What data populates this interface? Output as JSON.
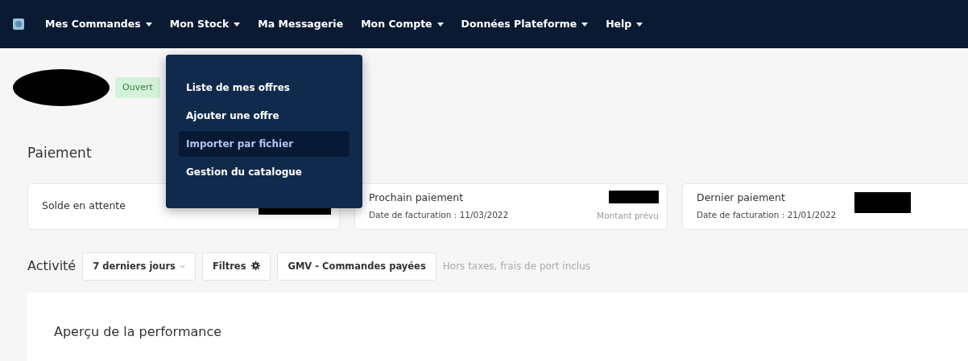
{
  "navbar": {
    "items": [
      {
        "label": "Mes Commandes",
        "caret": true,
        "expanded": false
      },
      {
        "label": "Mon Stock",
        "caret": true,
        "expanded": true
      },
      {
        "label": "Ma Messagerie",
        "caret": false,
        "expanded": false
      },
      {
        "label": "Mon Compte",
        "caret": true,
        "expanded": false
      },
      {
        "label": "Données Plateforme",
        "caret": true,
        "expanded": false
      },
      {
        "label": "Help",
        "caret": true,
        "expanded": false
      }
    ]
  },
  "dropdown_menu": {
    "items": [
      {
        "label": "Liste de mes offres",
        "selected": false
      },
      {
        "label": "Ajouter une offre",
        "selected": false
      },
      {
        "label": "Importer par fichier",
        "selected": true
      },
      {
        "label": "Gestion du catalogue",
        "selected": false
      }
    ]
  },
  "shop_header": {
    "status_badge": "Ouvert"
  },
  "payment": {
    "title": "Paiement",
    "cards": [
      {
        "title": "Solde en attente"
      },
      {
        "title": "Prochain paiement",
        "subtitle": "Date de facturation : 11/03/2022",
        "note": "Montant prévu"
      },
      {
        "title": "Dernier paiement",
        "subtitle": "Date de facturation : 21/01/2022"
      }
    ]
  },
  "activity": {
    "title": "Activité",
    "period_button": "7 derniers jours",
    "filters_button": "Filtres",
    "metric_button": "GMV - Commandes payées",
    "hint": "Hors taxes, frais de port inclus"
  },
  "performance": {
    "title": "Aperçu de la performance"
  }
}
